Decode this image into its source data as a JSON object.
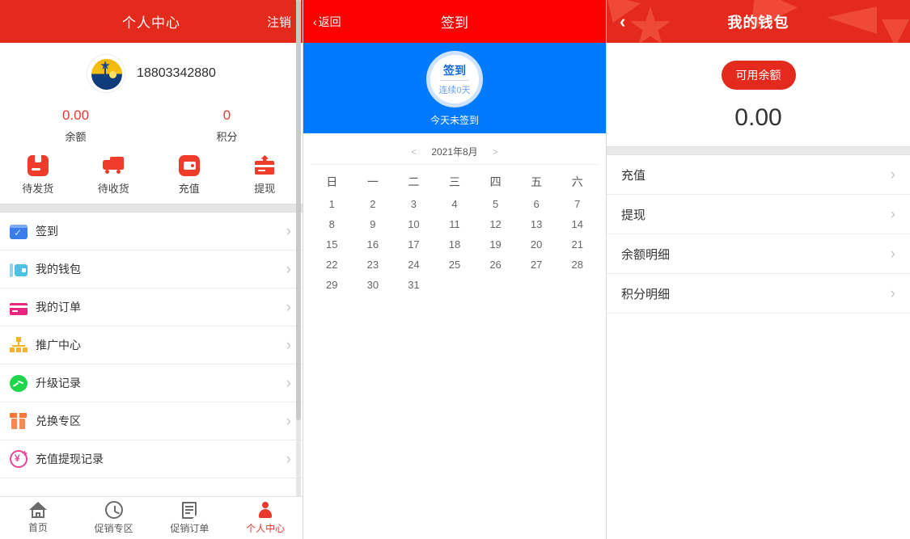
{
  "left": {
    "header": {
      "title": "个人中心",
      "logout": "注销"
    },
    "profile": {
      "phone": "18803342880",
      "avatar_icon": "globe-avatar-icon"
    },
    "stats": [
      {
        "value": "0.00",
        "label": "余额"
      },
      {
        "value": "0",
        "label": "积分"
      }
    ],
    "quick_actions": [
      {
        "label": "待发货",
        "icon": "package-icon"
      },
      {
        "label": "待收货",
        "icon": "truck-icon"
      },
      {
        "label": "充值",
        "icon": "wallet-icon"
      },
      {
        "label": "提现",
        "icon": "withdraw-card-icon"
      }
    ],
    "menu": [
      {
        "label": "签到",
        "icon": "calendar-check-icon"
      },
      {
        "label": "我的钱包",
        "icon": "wallet-blue-icon"
      },
      {
        "label": "我的订单",
        "icon": "order-card-icon"
      },
      {
        "label": "推广中心",
        "icon": "network-tree-icon"
      },
      {
        "label": "升级记录",
        "icon": "chart-circle-icon"
      },
      {
        "label": "兑换专区",
        "icon": "gift-icon"
      },
      {
        "label": "充值提现记录",
        "icon": "yuan-plus-icon"
      }
    ],
    "chevron": "›",
    "tabbar": [
      {
        "label": "首页",
        "icon": "home-icon",
        "active": false
      },
      {
        "label": "促销专区",
        "icon": "clock-icon",
        "active": false
      },
      {
        "label": "促销订单",
        "icon": "document-icon",
        "active": false
      },
      {
        "label": "个人中心",
        "icon": "user-icon",
        "active": true
      }
    ]
  },
  "middle": {
    "header": {
      "back": "返回",
      "back_icon": "chevron-left-icon",
      "title": "签到"
    },
    "signin": {
      "button_label": "签到",
      "streak": "连续0天",
      "status": "今天未签到"
    },
    "calendar": {
      "prev": "<",
      "next": ">",
      "month": "2021年8月",
      "weekdays": [
        "日",
        "一",
        "二",
        "三",
        "四",
        "五",
        "六"
      ],
      "lead_blanks": 0,
      "days": [
        1,
        2,
        3,
        4,
        5,
        6,
        7,
        8,
        9,
        10,
        11,
        12,
        13,
        14,
        15,
        16,
        17,
        18,
        19,
        20,
        21,
        22,
        23,
        24,
        25,
        26,
        27,
        28,
        29,
        30,
        31
      ]
    }
  },
  "right": {
    "header": {
      "title": "我的钱包",
      "back_icon": "chevron-left-icon"
    },
    "balance": {
      "badge": "可用余额",
      "amount": "0.00"
    },
    "menu": [
      {
        "label": "充值"
      },
      {
        "label": "提现"
      },
      {
        "label": "余额明细"
      },
      {
        "label": "积分明细"
      }
    ],
    "chevron": "›"
  },
  "colors": {
    "left_header_red": "#e42a1d",
    "mid_header_red": "#ff0000",
    "signin_blue": "#007bff",
    "accent_red": "#e8392c",
    "gray_band": "#e5e5e5"
  }
}
